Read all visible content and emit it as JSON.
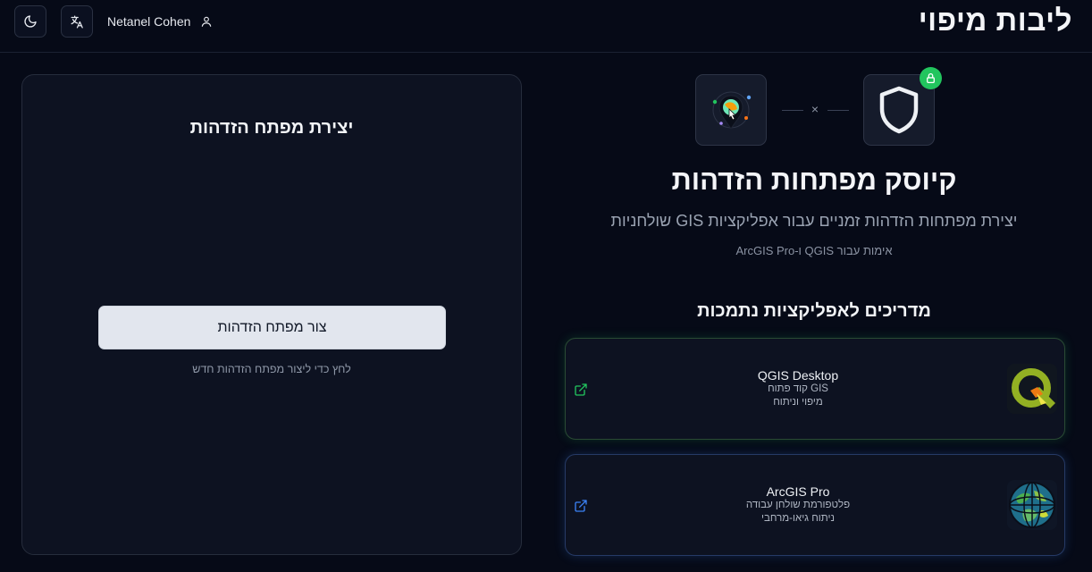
{
  "header": {
    "site_title": "ליבות מיפוי",
    "user_name": "Netanel Cohen",
    "theme_icon": "moon-icon",
    "language_icon": "translate-icon",
    "user_icon": "user-icon"
  },
  "create_panel": {
    "title": "יצירת מפתח הזדהות",
    "button_label": "צור מפתח הזדהות",
    "hint": "לחץ כדי ליצור מפתח הזדהות חדש"
  },
  "hero": {
    "separator": "×",
    "title": "קיוסק מפתחות הזדהות",
    "subtitle": "יצירת מפתחות הזדהות זמניים עבור אפליקציות GIS שולחניות",
    "auth_note": "אימות עבור QGIS ו-ArcGIS Pro",
    "logo_icon": "mapping-app-logo-icon",
    "shield_icon": "shield-icon",
    "lock_icon": "lock-icon"
  },
  "guides": {
    "title": "מדריכים לאפליקציות נתמכות",
    "apps": [
      {
        "name": "QGIS Desktop",
        "line1": "GIS קוד פתוח",
        "line2": "מיפוי וניתוח",
        "accent": "#22c55e",
        "link_icon": "external-link-icon"
      },
      {
        "name": "ArcGIS Pro",
        "line1": "פלטפורמת שולחן עבודה",
        "line2": "ניתוח גיאו-מרחבי",
        "accent": "#3b82f6",
        "link_icon": "external-link-icon"
      }
    ]
  },
  "colors": {
    "background": "#060a17",
    "card": "#0d1221",
    "button": "#e2e6ee",
    "green": "#22c55e",
    "blue": "#3b82f6"
  }
}
